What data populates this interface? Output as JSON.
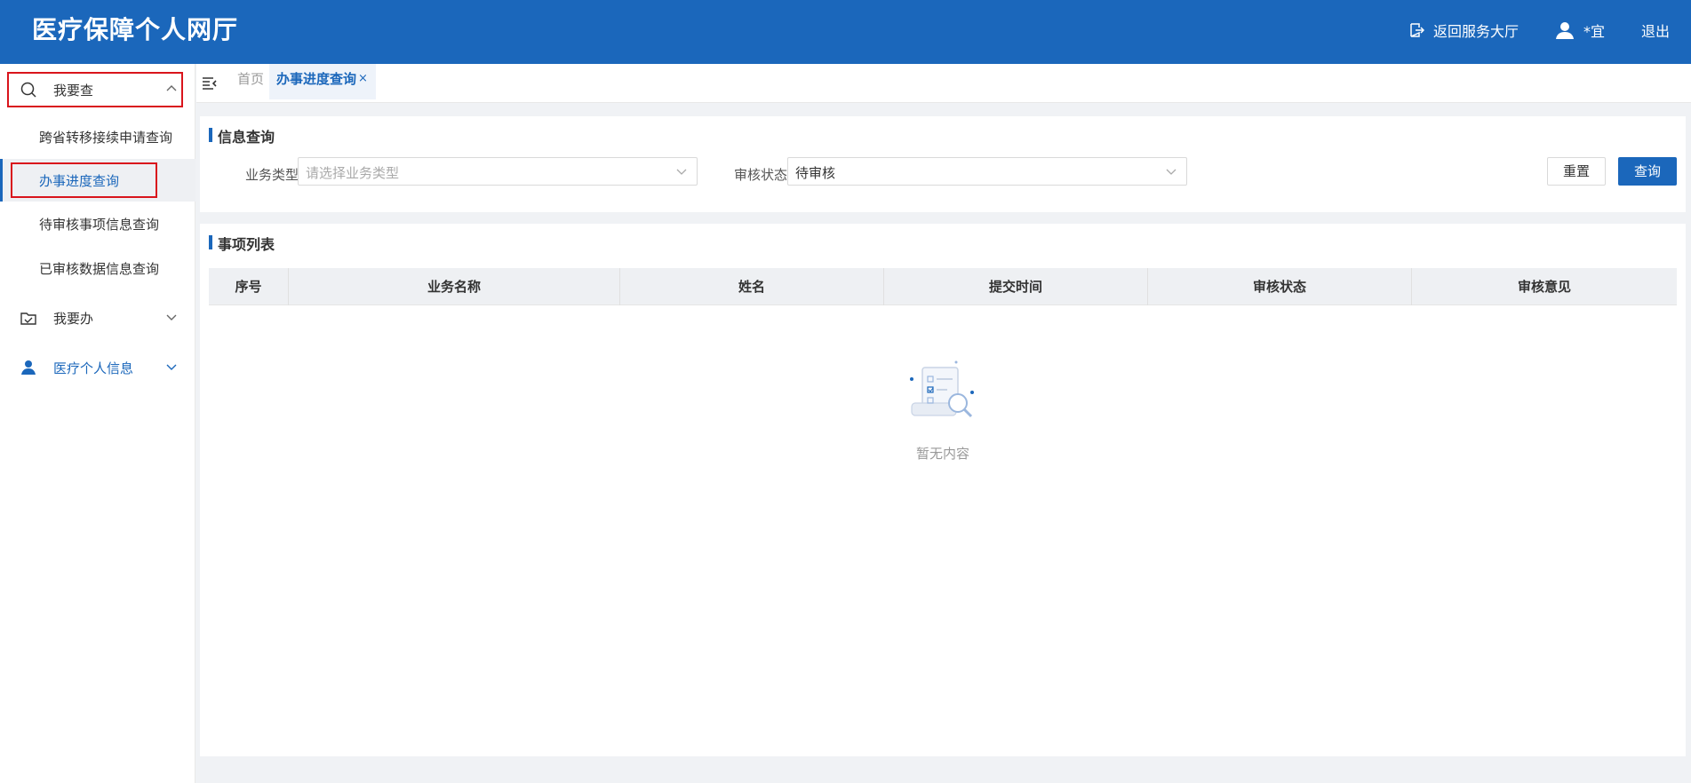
{
  "header": {
    "title": "医疗保障个人网厅",
    "back_label": "返回服务大厅",
    "user_name": "*宜",
    "logout_label": "退出"
  },
  "sidebar": {
    "groups": [
      {
        "label": "我要查",
        "icon": "search-icon",
        "expanded": true,
        "items": [
          {
            "label": "跨省转移接续申请查询"
          },
          {
            "label": "办事进度查询",
            "active": true
          },
          {
            "label": "待审核事项信息查询"
          },
          {
            "label": "已审核数据信息查询"
          }
        ]
      },
      {
        "label": "我要办",
        "icon": "folder-check-icon",
        "expanded": false
      },
      {
        "label": "医疗个人信息",
        "icon": "person-icon",
        "expanded": false
      }
    ]
  },
  "tabs": {
    "home": "首页",
    "current": "办事进度查询",
    "close": "×"
  },
  "query": {
    "title": "信息查询",
    "biz_type_label": "业务类型",
    "biz_type_placeholder": "请选择业务类型",
    "status_label": "审核状态",
    "status_value": "待审核",
    "reset_label": "重置",
    "search_label": "查询"
  },
  "list": {
    "title": "事项列表",
    "columns": [
      "序号",
      "业务名称",
      "姓名",
      "提交时间",
      "审核状态",
      "审核意见"
    ],
    "empty_text": "暂无内容"
  },
  "colors": {
    "primary": "#1b67bb",
    "highlight": "#d9141c"
  }
}
